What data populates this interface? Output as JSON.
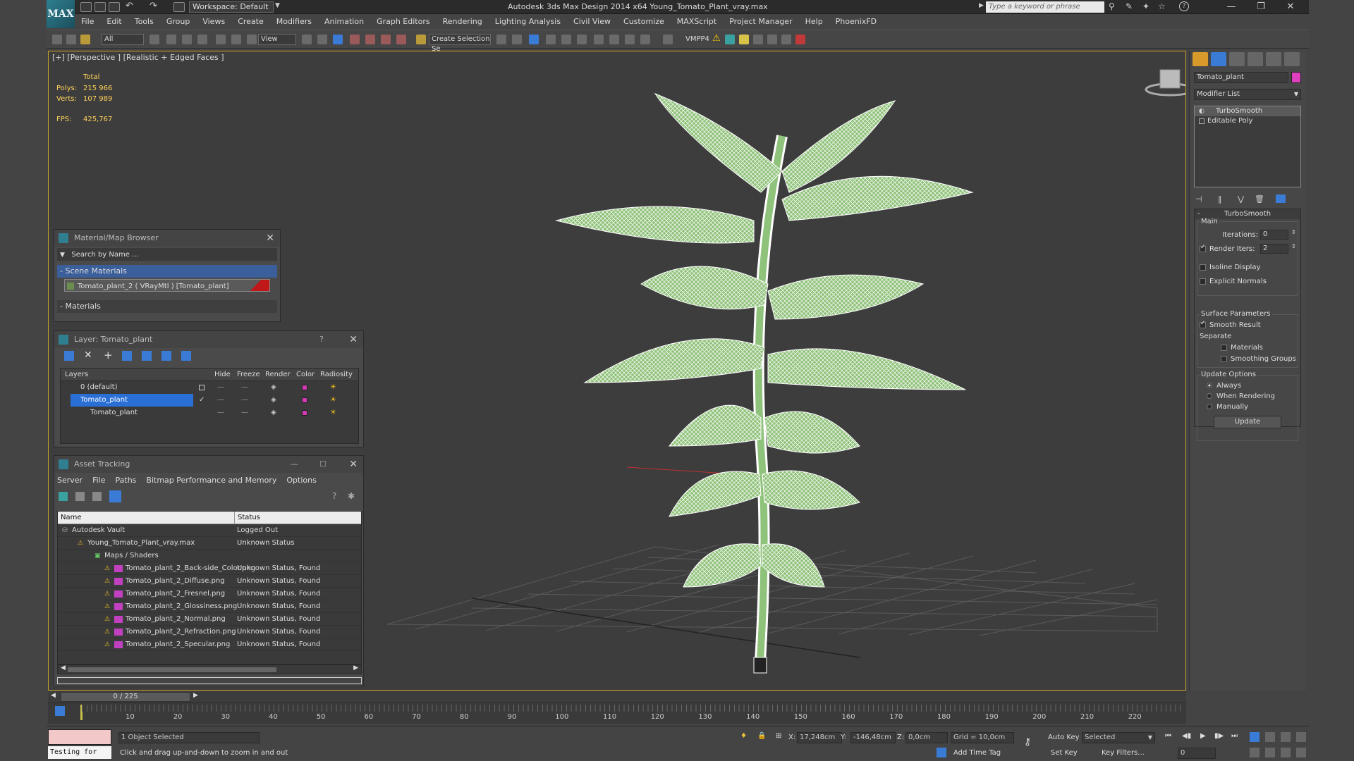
{
  "app": {
    "logo": "MAX",
    "workspace": "Workspace: Default",
    "title": "Autodesk 3ds Max Design 2014 x64      Young_Tomato_Plant_vray.max",
    "search_placeholder": "Type a keyword or phrase"
  },
  "menu": [
    "File",
    "Edit",
    "Tools",
    "Group",
    "Views",
    "Create",
    "Modifiers",
    "Animation",
    "Graph Editors",
    "Rendering",
    "Lighting Analysis",
    "Civil View",
    "Customize",
    "MAXScript",
    "Project Manager",
    "Help",
    "PhoenixFD"
  ],
  "toolbar": {
    "filter": "All",
    "ref_coord": "View",
    "selection_set": "Create Selection Se",
    "renderer_label": "VMPP4"
  },
  "viewport": {
    "label": "[+] [Perspective ] [Realistic + Edged Faces ]",
    "stats_header": "Total",
    "polys_label": "Polys:",
    "polys_value": "215 966",
    "verts_label": "Verts:",
    "verts_value": "107 989",
    "fps_label": "FPS:",
    "fps_value": "425,767"
  },
  "material_browser": {
    "title": "Material/Map Browser",
    "search_placeholder": "Search by Name ...",
    "section_scene": "- Scene Materials",
    "material_item": "Tomato_plant_2  ( VRayMtl ) [Tomato_plant]",
    "section_materials": "- Materials"
  },
  "layer_manager": {
    "title": "Layer: Tomato_plant",
    "help": "?",
    "columns": [
      "Layers",
      "Hide",
      "Freeze",
      "Render",
      "Color",
      "Radiosity"
    ],
    "rows": [
      {
        "name": "0 (default)"
      },
      {
        "name": "Tomato_plant"
      },
      {
        "name": "Tomato_plant"
      }
    ]
  },
  "asset_tracking": {
    "title": "Asset Tracking",
    "menu": [
      "Server",
      "File",
      "Paths",
      "Bitmap Performance and Memory",
      "Options"
    ],
    "columns": [
      "Name",
      "Status"
    ],
    "rows": [
      {
        "name": "Autodesk Vault",
        "status": "Logged Out"
      },
      {
        "name": "Young_Tomato_Plant_vray.max",
        "status": "Unknown Status"
      },
      {
        "name": "Maps / Shaders",
        "status": ""
      },
      {
        "name": "Tomato_plant_2_Back-side_Color.png",
        "status": "Unknown Status, Found"
      },
      {
        "name": "Tomato_plant_2_Diffuse.png",
        "status": "Unknown Status, Found"
      },
      {
        "name": "Tomato_plant_2_Fresnel.png",
        "status": "Unknown Status, Found"
      },
      {
        "name": "Tomato_plant_2_Glossiness.png",
        "status": "Unknown Status, Found"
      },
      {
        "name": "Tomato_plant_2_Normal.png",
        "status": "Unknown Status, Found"
      },
      {
        "name": "Tomato_plant_2_Refraction.png",
        "status": "Unknown Status, Found"
      },
      {
        "name": "Tomato_plant_2_Specular.png",
        "status": "Unknown Status, Found"
      }
    ]
  },
  "command_panel": {
    "object_name": "Tomato_plant",
    "object_color": "#e040c0",
    "modifier_list": "Modifier List",
    "stack": [
      "TurboSmooth",
      "Editable Poly"
    ],
    "rollout_title": "TurboSmooth",
    "main_label": "Main",
    "iterations_label": "Iterations:",
    "iterations_value": "0",
    "render_iters_label": "Render Iters:",
    "render_iters_value": "2",
    "isoline_display": "Isoline Display",
    "explicit_normals": "Explicit Normals",
    "surface_params": "Surface Parameters",
    "smooth_result": "Smooth Result",
    "separate_label": "Separate",
    "materials": "Materials",
    "smoothing_groups": "Smoothing Groups",
    "update_options": "Update Options",
    "always": "Always",
    "when_rendering": "When Rendering",
    "manually": "Manually",
    "update_button": "Update"
  },
  "timeline": {
    "frame_counter": "0 / 225",
    "ticks": [
      "10",
      "20",
      "30",
      "40",
      "50",
      "60",
      "70",
      "80",
      "90",
      "100",
      "110",
      "120",
      "130",
      "140",
      "150",
      "160",
      "170",
      "180",
      "190",
      "200",
      "210",
      "220"
    ]
  },
  "statusbar": {
    "maxscript": "Testing for",
    "selection": "1 Object Selected",
    "prompt": "Click and drag up-and-down to zoom in and out",
    "x_label": "X:",
    "x_value": "17,248cm",
    "y_label": "Y:",
    "y_value": "-146,48cm",
    "z_label": "Z:",
    "z_value": "0,0cm",
    "grid": "Grid = 10,0cm",
    "add_time_tag": "Add Time Tag",
    "auto_key": "Auto Key",
    "set_key": "Set Key",
    "selected": "Selected",
    "key_filters": "Key Filters...",
    "frame_value": "0"
  },
  "colors": {
    "viewport_border": "#c9a227",
    "selection_blue": "#2a6fd6",
    "stat_yellow": "#ffd35a",
    "wire_white": "#ffffff",
    "leaf_green": "#8fc27a",
    "layer_color": "#d23ab4"
  },
  "icons": [
    "search-icon",
    "undo-icon",
    "redo-icon",
    "help-icon",
    "close-icon",
    "minimize-icon",
    "maximize-icon",
    "warning-icon",
    "png-file-icon",
    "key-icon",
    "lock-icon",
    "play-icon"
  ]
}
